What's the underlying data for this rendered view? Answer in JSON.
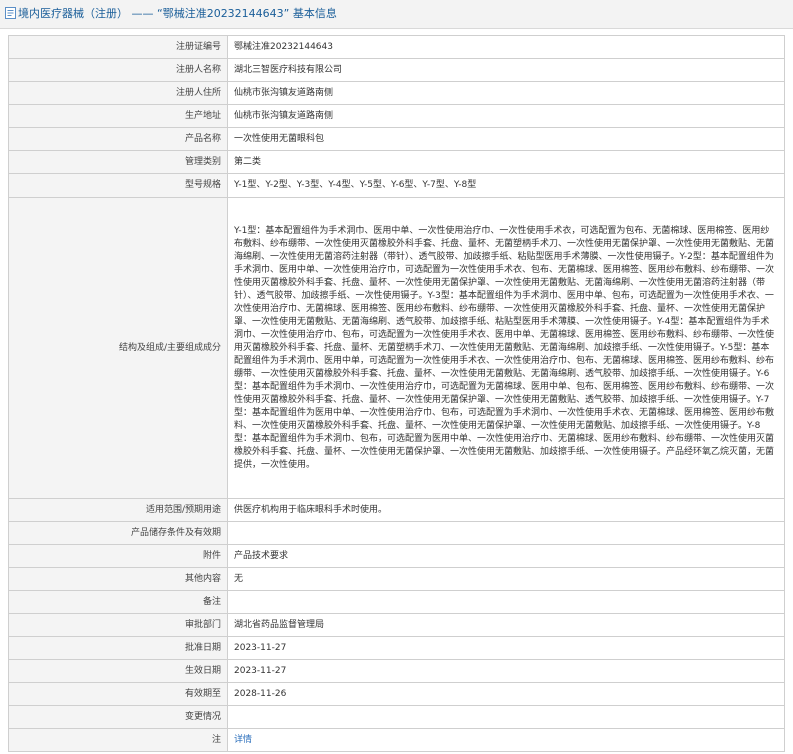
{
  "header": {
    "icon": "document-icon",
    "title": "境内医疗器械（注册） —— “鄂械注准20232144643” 基本信息"
  },
  "fields": [
    {
      "label": "注册证编号",
      "value": "鄂械注准20232144643"
    },
    {
      "label": "注册人名称",
      "value": "湖北三智医疗科技有限公司"
    },
    {
      "label": "注册人住所",
      "value": "仙桃市张沟镇友道路南侧"
    },
    {
      "label": "生产地址",
      "value": "仙桃市张沟镇友道路南侧"
    },
    {
      "label": "产品名称",
      "value": "一次性使用无菌眼科包"
    },
    {
      "label": "管理类别",
      "value": "第二类"
    },
    {
      "label": "型号规格",
      "value": "Y-1型、Y-2型、Y-3型、Y-4型、Y-5型、Y-6型、Y-7型、Y-8型"
    },
    {
      "label": "结构及组成/主要组成成分",
      "value": "Y-1型：基本配置组件为手术洞巾、医用中单、一次性使用治疗巾、一次性使用手术衣，可选配置为包布、无菌棉球、医用棉签、医用纱布敷料、纱布绷带、一次性使用灭菌橡胶外科手套、托盘、量杯、无菌塑柄手术刀、一次性使用无菌保护罩、一次性使用无菌敷贴、无菌海绵刷、一次性使用无菌溶药注射器（带针）、透气胶带、加歧擦手纸、粘贴型医用手术薄膜、一次性使用镊子。Y-2型：基本配置组件为手术洞巾、医用中单、一次性使用治疗巾，可选配置为一次性使用手术衣、包布、无菌棉球、医用棉签、医用纱布敷料、纱布绷带、一次性使用灭菌橡胶外科手套、托盘、量杯、一次性使用无菌保护罩、一次性使用无菌敷贴、无菌海绵刷、一次性使用无菌溶药注射器（带针）、透气胶带、加歧擦手纸、一次性使用镊子。Y-3型：基本配置组件为手术洞巾、医用中单、包布，可选配置为一次性使用手术衣、一次性使用治疗巾、无菌棉球、医用棉签、医用纱布敷料、纱布绷带、一次性使用灭菌橡胶外科手套、托盘、量杯、一次性使用无菌保护罩、一次性使用无菌敷贴、无菌海绵刷、透气胶带、加歧擦手纸、粘贴型医用手术薄膜、一次性使用镊子。Y-4型：基本配置组件为手术洞巾、一次性使用治疗巾、包布，可选配置为一次性使用手术衣、医用中单、无菌棉球、医用棉签、医用纱布敷料、纱布绷带、一次性使用灭菌橡胶外科手套、托盘、量杯、无菌塑柄手术刀、一次性使用无菌敷贴、无菌海绵刷、加歧擦手纸、一次性使用镊子。Y-5型：基本配置组件为手术洞巾、医用中单，可选配置为一次性使用手术衣、一次性使用治疗巾、包布、无菌棉球、医用棉签、医用纱布敷料、纱布绷带、一次性使用灭菌橡胶外科手套、托盘、量杯、一次性使用无菌敷贴、无菌海绵刷、透气胶带、加歧擦手纸、一次性使用镊子。Y-6型：基本配置组件为手术洞巾、一次性使用治疗巾，可选配置为无菌棉球、医用中单、包布、医用棉签、医用纱布敷料、纱布绷带、一次性使用灭菌橡胶外科手套、托盘、量杯、一次性使用无菌保护罩、一次性使用无菌敷贴、透气胶带、加歧擦手纸、一次性使用镊子。Y-7型：基本配置组件为医用中单、一次性使用治疗巾、包布，可选配置为手术洞巾、一次性使用手术衣、无菌棉球、医用棉签、医用纱布敷料、一次性使用灭菌橡胶外科手套、托盘、量杯、一次性使用无菌保护罩、一次性使用无菌敷贴、加歧擦手纸、一次性使用镊子。Y-8型：基本配置组件为手术洞巾、包布，可选配置为医用中单、一次性使用治疗巾、无菌棉球、医用纱布敷料、纱布绷带、一次性使用灭菌橡胶外科手套、托盘、量杯、一次性使用无菌保护罩、一次性使用无菌敷贴、加歧擦手纸、一次性使用镊子。产品经环氧乙烷灭菌，无菌提供，一次性使用。"
    },
    {
      "label": "适用范围/预期用途",
      "value": "供医疗机构用于临床眼科手术时使用。"
    },
    {
      "label": "产品储存条件及有效期",
      "value": ""
    },
    {
      "label": "附件",
      "value": "产品技术要求"
    },
    {
      "label": "其他内容",
      "value": "无"
    },
    {
      "label": "备注",
      "value": ""
    },
    {
      "label": "审批部门",
      "value": "湖北省药品监督管理局"
    },
    {
      "label": "批准日期",
      "value": "2023-11-27"
    },
    {
      "label": "生效日期",
      "value": "2023-11-27"
    },
    {
      "label": "有效期至",
      "value": "2028-11-26"
    },
    {
      "label": "变更情况",
      "value": ""
    },
    {
      "label": "注",
      "value": "详情"
    }
  ]
}
